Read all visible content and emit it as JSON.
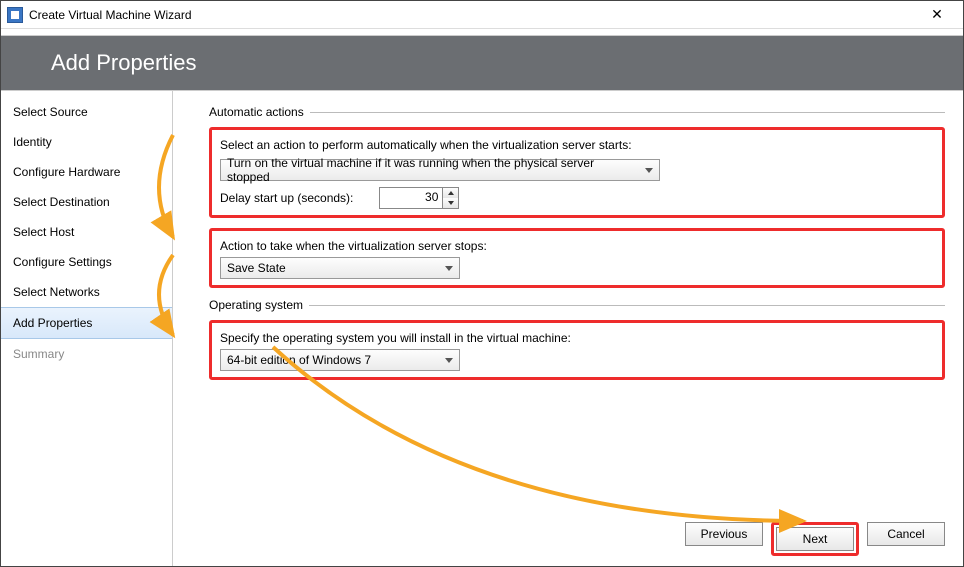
{
  "window": {
    "title": "Create Virtual Machine Wizard"
  },
  "header": {
    "title": "Add Properties"
  },
  "sidebar": {
    "items": [
      {
        "label": "Select Source"
      },
      {
        "label": "Identity"
      },
      {
        "label": "Configure Hardware"
      },
      {
        "label": "Select Destination"
      },
      {
        "label": "Select Host"
      },
      {
        "label": "Configure Settings"
      },
      {
        "label": "Select Networks"
      },
      {
        "label": "Add Properties"
      },
      {
        "label": "Summary"
      }
    ]
  },
  "content": {
    "auto_section": "Automatic actions",
    "start_label": "Select an action to perform automatically when the virtualization server starts:",
    "start_value": "Turn on the virtual machine if it was running when the physical server stopped",
    "delay_label": "Delay start up (seconds):",
    "delay_value": "30",
    "stop_label": "Action to take when the virtualization server stops:",
    "stop_value": "Save State",
    "os_section": "Operating system",
    "os_label": "Specify the operating system you will install in the virtual machine:",
    "os_value": "64-bit edition of Windows 7"
  },
  "buttons": {
    "previous": "Previous",
    "next": "Next",
    "cancel": "Cancel"
  }
}
